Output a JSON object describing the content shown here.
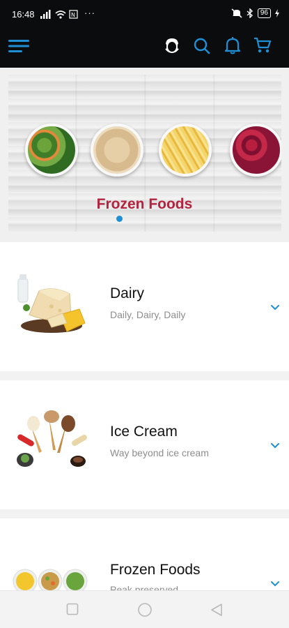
{
  "status_bar": {
    "time": "16:48",
    "dots": "···",
    "battery": "96"
  },
  "app_bar": {
    "icons": [
      "menu-icon",
      "support-agent-icon",
      "search-icon",
      "bell-icon",
      "cart-icon"
    ],
    "accent_color": "#1f8fd6"
  },
  "banner": {
    "title": "Frozen Foods",
    "title_color": "#b2243f",
    "slides_total": 1,
    "active_slide": 1
  },
  "categories": [
    {
      "title": "Dairy",
      "subtitle": "Daily, Dairy, Daily"
    },
    {
      "title": "Ice Cream",
      "subtitle": "Way beyond ice cream"
    },
    {
      "title": "Frozen Foods",
      "subtitle": "Peak preserved"
    }
  ],
  "nav_bar": {
    "icons": [
      "square-icon",
      "circle-icon",
      "triangle-back-icon"
    ]
  }
}
